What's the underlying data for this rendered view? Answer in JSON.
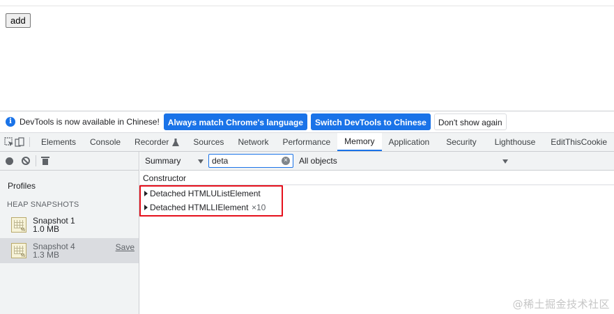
{
  "page": {
    "add_button": "add"
  },
  "infobar": {
    "message": "DevTools is now available in Chinese!",
    "btn_match": "Always match Chrome's language",
    "btn_switch": "Switch DevTools to Chinese",
    "btn_dismiss": "Don't show again"
  },
  "tabs": [
    "Elements",
    "Console",
    "Recorder",
    "Sources",
    "Network",
    "Performance",
    "Memory",
    "Application",
    "Security",
    "Lighthouse",
    "EditThisCookie"
  ],
  "active_tab": "Memory",
  "sidebar": {
    "profiles_label": "Profiles",
    "heap_section": "HEAP SNAPSHOTS",
    "snapshots": [
      {
        "name": "Snapshot 1",
        "size": "1.0 MB"
      },
      {
        "name": "Snapshot 4",
        "size": "1.3 MB",
        "save": "Save"
      }
    ]
  },
  "toolbar": {
    "view_select": "Summary",
    "filter_value": "deta",
    "objects_select": "All objects"
  },
  "grid": {
    "header": "Constructor",
    "rows": [
      {
        "name": "Detached HTMLUListElement",
        "count": ""
      },
      {
        "name": "Detached HTMLLIElement",
        "count": "×10"
      }
    ]
  },
  "watermark": "@稀土掘金技术社区",
  "colors": {
    "accent": "#1a73e8",
    "highlight": "#e5101c"
  }
}
